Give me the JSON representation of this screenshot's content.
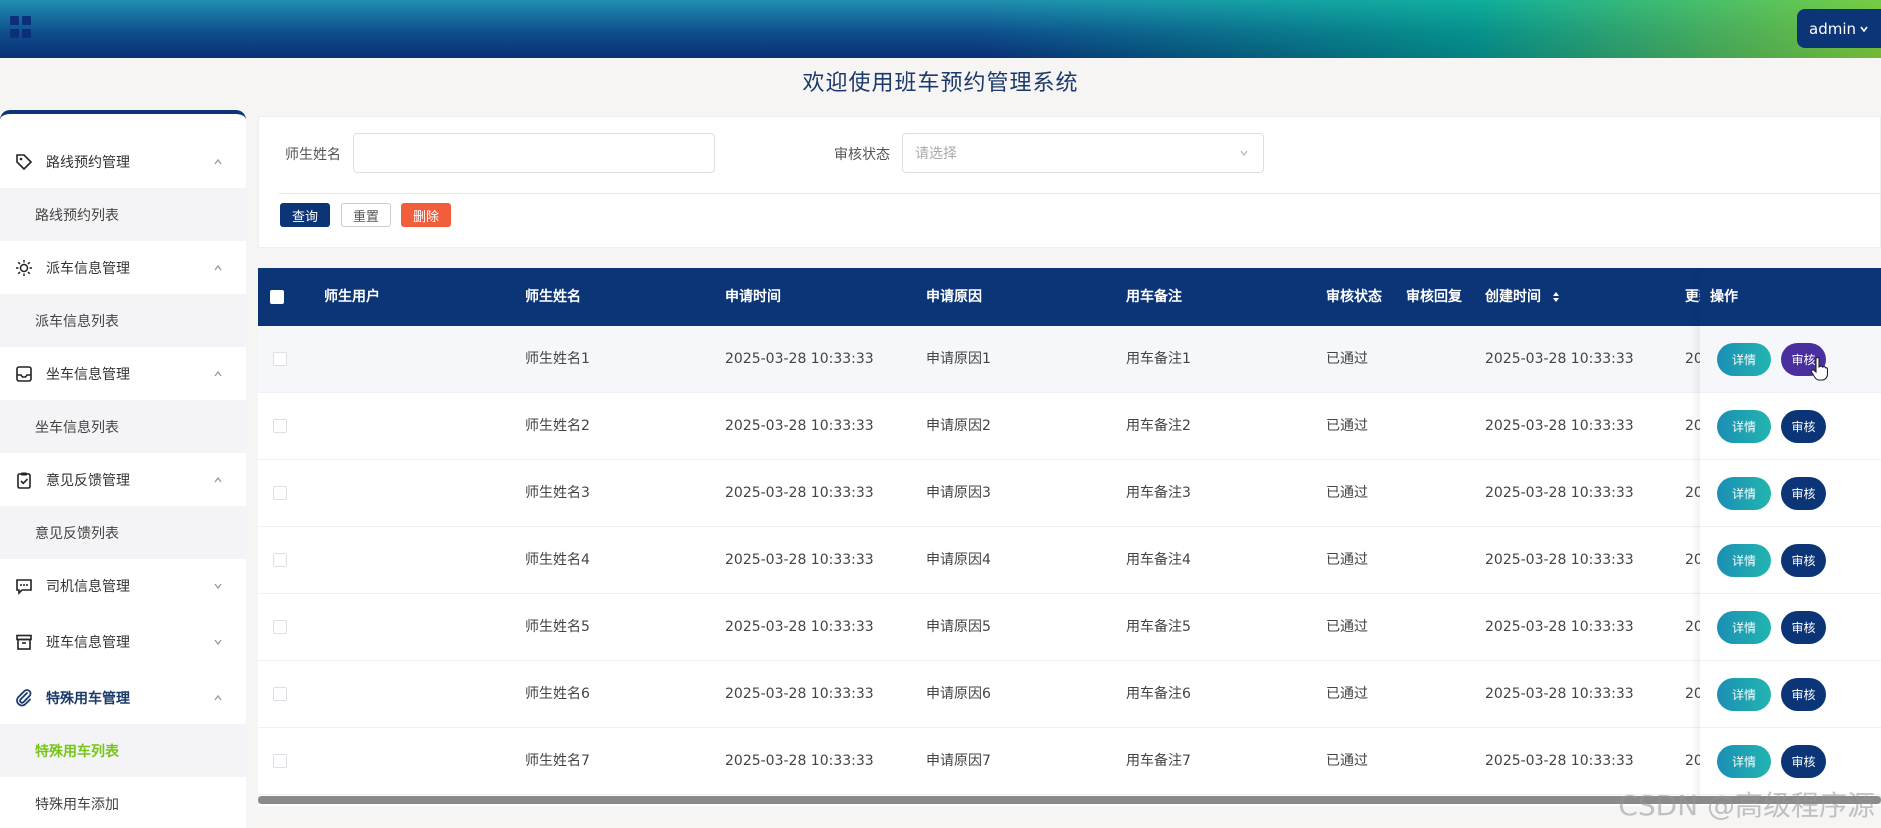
{
  "header": {
    "user_label": "admin",
    "welcome_title": "欢迎使用班车预约管理系统"
  },
  "sidebar": {
    "groups": [
      {
        "label": "路线预约管理",
        "icon": "tag-icon",
        "expanded": true,
        "sub": [
          "路线预约列表"
        ]
      },
      {
        "label": "派车信息管理",
        "icon": "sun-icon",
        "expanded": true,
        "sub": [
          "派车信息列表"
        ]
      },
      {
        "label": "坐车信息管理",
        "icon": "inbox-icon",
        "expanded": true,
        "sub": [
          "坐车信息列表"
        ]
      },
      {
        "label": "意见反馈管理",
        "icon": "clipboard-check-icon",
        "expanded": true,
        "sub": [
          "意见反馈列表"
        ]
      },
      {
        "label": "司机信息管理",
        "icon": "chat-icon",
        "expanded": false,
        "sub": []
      },
      {
        "label": "班车信息管理",
        "icon": "archive-icon",
        "expanded": false,
        "sub": []
      },
      {
        "label": "特殊用车管理",
        "icon": "paperclip-icon",
        "expanded": true,
        "active": true,
        "sub": [
          "特殊用车列表",
          "特殊用车添加"
        ]
      }
    ]
  },
  "search": {
    "name_label": "师生姓名",
    "name_value": "",
    "status_label": "审核状态",
    "status_placeholder": "请选择",
    "query_btn": "查询",
    "reset_btn": "重置",
    "delete_btn": "删除"
  },
  "table": {
    "columns": [
      "师生用户",
      "师生姓名",
      "申请时间",
      "申请原因",
      "用车备注",
      "审核状态",
      "审核回复",
      "创建时间",
      "更新",
      "操作"
    ],
    "rows": [
      {
        "user": "",
        "name": "师生姓名1",
        "apply_time": "2025-03-28 10:33:33",
        "reason": "申请原因1",
        "remark": "用车备注1",
        "status": "已通过",
        "reply": "",
        "created": "2025-03-28 10:33:33",
        "updated": "20"
      },
      {
        "user": "",
        "name": "师生姓名2",
        "apply_time": "2025-03-28 10:33:33",
        "reason": "申请原因2",
        "remark": "用车备注2",
        "status": "已通过",
        "reply": "",
        "created": "2025-03-28 10:33:33",
        "updated": "20"
      },
      {
        "user": "",
        "name": "师生姓名3",
        "apply_time": "2025-03-28 10:33:33",
        "reason": "申请原因3",
        "remark": "用车备注3",
        "status": "已通过",
        "reply": "",
        "created": "2025-03-28 10:33:33",
        "updated": "20"
      },
      {
        "user": "",
        "name": "师生姓名4",
        "apply_time": "2025-03-28 10:33:33",
        "reason": "申请原因4",
        "remark": "用车备注4",
        "status": "已通过",
        "reply": "",
        "created": "2025-03-28 10:33:33",
        "updated": "20"
      },
      {
        "user": "",
        "name": "师生姓名5",
        "apply_time": "2025-03-28 10:33:33",
        "reason": "申请原因5",
        "remark": "用车备注5",
        "status": "已通过",
        "reply": "",
        "created": "2025-03-28 10:33:33",
        "updated": "20"
      },
      {
        "user": "",
        "name": "师生姓名6",
        "apply_time": "2025-03-28 10:33:33",
        "reason": "申请原因6",
        "remark": "用车备注6",
        "status": "已通过",
        "reply": "",
        "created": "2025-03-28 10:33:33",
        "updated": "20"
      },
      {
        "user": "",
        "name": "师生姓名7",
        "apply_time": "2025-03-28 10:33:33",
        "reason": "申请原因7",
        "remark": "用车备注7",
        "status": "已通过",
        "reply": "",
        "created": "2025-03-28 10:33:33",
        "updated": "20"
      }
    ],
    "detail_btn": "详情",
    "audit_btn": "审核"
  },
  "watermark": "CSDN @高级程序源",
  "colors": {
    "primary": "#0b3577",
    "delete": "#f25d3c",
    "active_submenu": "#79c31b",
    "audit_hover": "#4a2f9e"
  }
}
